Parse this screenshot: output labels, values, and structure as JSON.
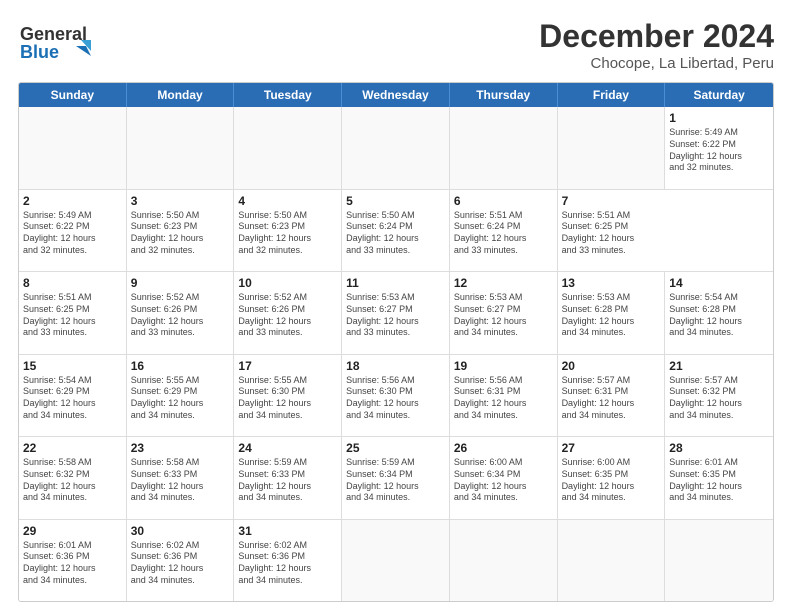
{
  "header": {
    "logo_line1": "General",
    "logo_line2": "Blue",
    "title": "December 2024",
    "subtitle": "Chocope, La Libertad, Peru"
  },
  "calendar": {
    "days_of_week": [
      "Sunday",
      "Monday",
      "Tuesday",
      "Wednesday",
      "Thursday",
      "Friday",
      "Saturday"
    ],
    "weeks": [
      [
        {
          "day": "",
          "info": ""
        },
        {
          "day": "",
          "info": ""
        },
        {
          "day": "",
          "info": ""
        },
        {
          "day": "",
          "info": ""
        },
        {
          "day": "",
          "info": ""
        },
        {
          "day": "",
          "info": ""
        },
        {
          "day": "1",
          "info": "Sunrise: 5:49 AM\nSunset: 6:22 PM\nDaylight: 12 hours\nand 32 minutes."
        }
      ],
      [
        {
          "day": "2",
          "info": "Sunrise: 5:49 AM\nSunset: 6:22 PM\nDaylight: 12 hours\nand 32 minutes."
        },
        {
          "day": "3",
          "info": "Sunrise: 5:50 AM\nSunset: 6:23 PM\nDaylight: 12 hours\nand 32 minutes."
        },
        {
          "day": "4",
          "info": "Sunrise: 5:50 AM\nSunset: 6:23 PM\nDaylight: 12 hours\nand 32 minutes."
        },
        {
          "day": "5",
          "info": "Sunrise: 5:50 AM\nSunset: 6:24 PM\nDaylight: 12 hours\nand 33 minutes."
        },
        {
          "day": "6",
          "info": "Sunrise: 5:51 AM\nSunset: 6:24 PM\nDaylight: 12 hours\nand 33 minutes."
        },
        {
          "day": "7",
          "info": "Sunrise: 5:51 AM\nSunset: 6:25 PM\nDaylight: 12 hours\nand 33 minutes."
        }
      ],
      [
        {
          "day": "8",
          "info": "Sunrise: 5:51 AM\nSunset: 6:25 PM\nDaylight: 12 hours\nand 33 minutes."
        },
        {
          "day": "9",
          "info": "Sunrise: 5:52 AM\nSunset: 6:26 PM\nDaylight: 12 hours\nand 33 minutes."
        },
        {
          "day": "10",
          "info": "Sunrise: 5:52 AM\nSunset: 6:26 PM\nDaylight: 12 hours\nand 33 minutes."
        },
        {
          "day": "11",
          "info": "Sunrise: 5:53 AM\nSunset: 6:27 PM\nDaylight: 12 hours\nand 33 minutes."
        },
        {
          "day": "12",
          "info": "Sunrise: 5:53 AM\nSunset: 6:27 PM\nDaylight: 12 hours\nand 34 minutes."
        },
        {
          "day": "13",
          "info": "Sunrise: 5:53 AM\nSunset: 6:28 PM\nDaylight: 12 hours\nand 34 minutes."
        },
        {
          "day": "14",
          "info": "Sunrise: 5:54 AM\nSunset: 6:28 PM\nDaylight: 12 hours\nand 34 minutes."
        }
      ],
      [
        {
          "day": "15",
          "info": "Sunrise: 5:54 AM\nSunset: 6:29 PM\nDaylight: 12 hours\nand 34 minutes."
        },
        {
          "day": "16",
          "info": "Sunrise: 5:55 AM\nSunset: 6:29 PM\nDaylight: 12 hours\nand 34 minutes."
        },
        {
          "day": "17",
          "info": "Sunrise: 5:55 AM\nSunset: 6:30 PM\nDaylight: 12 hours\nand 34 minutes."
        },
        {
          "day": "18",
          "info": "Sunrise: 5:56 AM\nSunset: 6:30 PM\nDaylight: 12 hours\nand 34 minutes."
        },
        {
          "day": "19",
          "info": "Sunrise: 5:56 AM\nSunset: 6:31 PM\nDaylight: 12 hours\nand 34 minutes."
        },
        {
          "day": "20",
          "info": "Sunrise: 5:57 AM\nSunset: 6:31 PM\nDaylight: 12 hours\nand 34 minutes."
        },
        {
          "day": "21",
          "info": "Sunrise: 5:57 AM\nSunset: 6:32 PM\nDaylight: 12 hours\nand 34 minutes."
        }
      ],
      [
        {
          "day": "22",
          "info": "Sunrise: 5:58 AM\nSunset: 6:32 PM\nDaylight: 12 hours\nand 34 minutes."
        },
        {
          "day": "23",
          "info": "Sunrise: 5:58 AM\nSunset: 6:33 PM\nDaylight: 12 hours\nand 34 minutes."
        },
        {
          "day": "24",
          "info": "Sunrise: 5:59 AM\nSunset: 6:33 PM\nDaylight: 12 hours\nand 34 minutes."
        },
        {
          "day": "25",
          "info": "Sunrise: 5:59 AM\nSunset: 6:34 PM\nDaylight: 12 hours\nand 34 minutes."
        },
        {
          "day": "26",
          "info": "Sunrise: 6:00 AM\nSunset: 6:34 PM\nDaylight: 12 hours\nand 34 minutes."
        },
        {
          "day": "27",
          "info": "Sunrise: 6:00 AM\nSunset: 6:35 PM\nDaylight: 12 hours\nand 34 minutes."
        },
        {
          "day": "28",
          "info": "Sunrise: 6:01 AM\nSunset: 6:35 PM\nDaylight: 12 hours\nand 34 minutes."
        }
      ],
      [
        {
          "day": "29",
          "info": "Sunrise: 6:01 AM\nSunset: 6:36 PM\nDaylight: 12 hours\nand 34 minutes."
        },
        {
          "day": "30",
          "info": "Sunrise: 6:02 AM\nSunset: 6:36 PM\nDaylight: 12 hours\nand 34 minutes."
        },
        {
          "day": "31",
          "info": "Sunrise: 6:02 AM\nSunset: 6:36 PM\nDaylight: 12 hours\nand 34 minutes."
        },
        {
          "day": "",
          "info": ""
        },
        {
          "day": "",
          "info": ""
        },
        {
          "day": "",
          "info": ""
        },
        {
          "day": "",
          "info": ""
        }
      ]
    ]
  }
}
